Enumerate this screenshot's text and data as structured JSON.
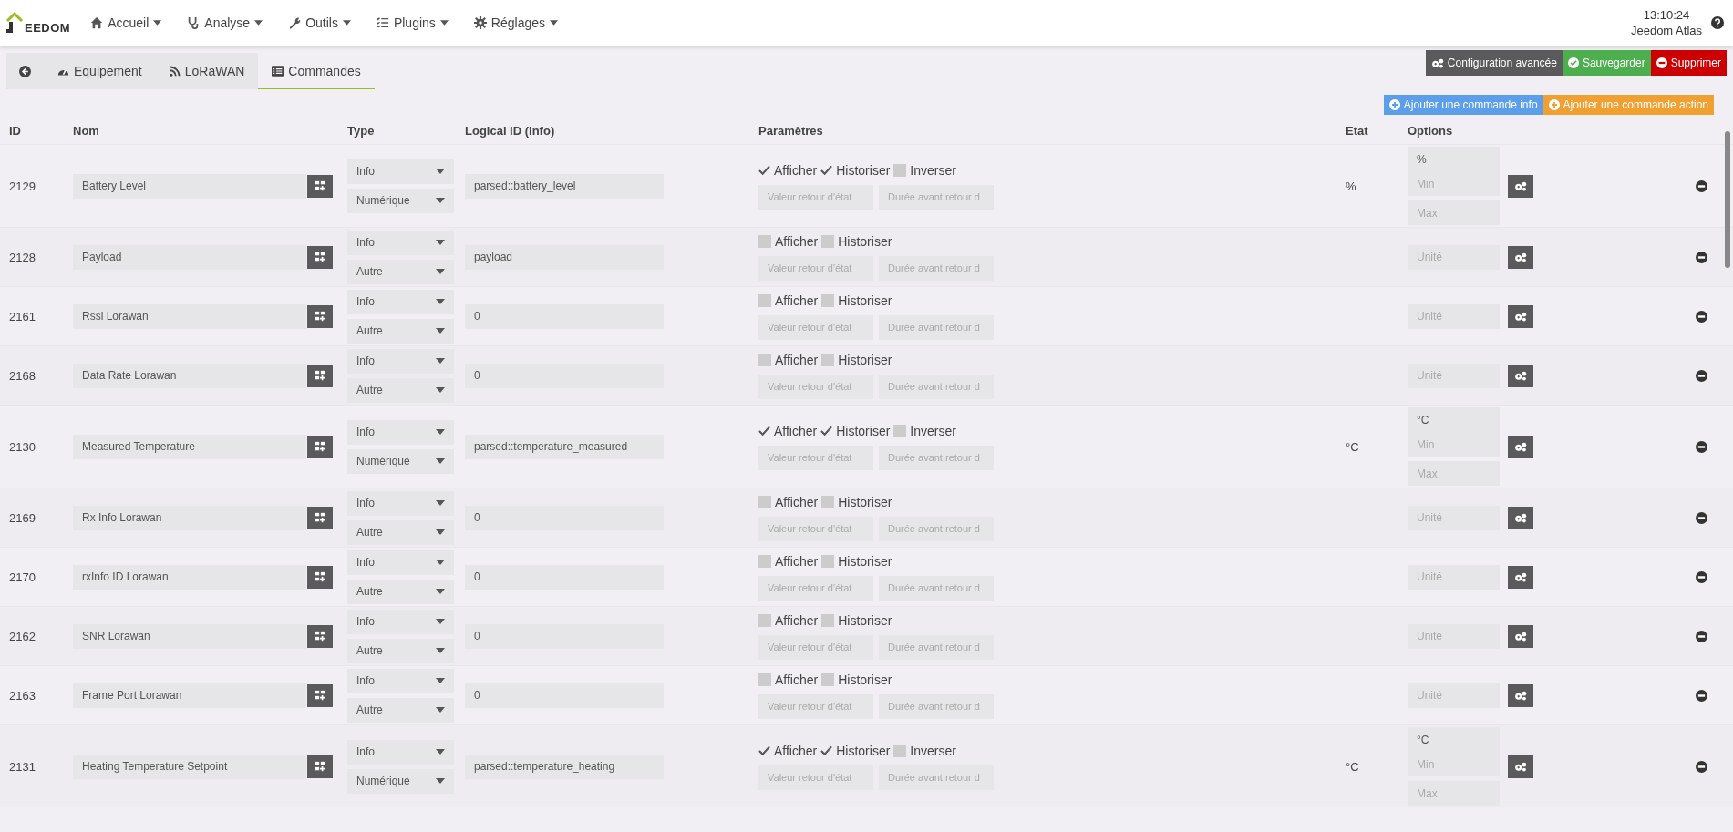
{
  "header": {
    "logo_text": "EEDOM",
    "nav": [
      {
        "label": "Accueil"
      },
      {
        "label": "Analyse"
      },
      {
        "label": "Outils"
      },
      {
        "label": "Plugins"
      },
      {
        "label": "Réglages"
      }
    ],
    "clock": "13:10:24",
    "user": "Jeedom Atlas"
  },
  "tabs": [
    {
      "label": "Equipement",
      "selected": false
    },
    {
      "label": "LoRaWAN",
      "selected": false
    },
    {
      "label": "Commandes",
      "selected": true
    }
  ],
  "actions": [
    "Configuration avancée",
    "Sauvegarder",
    "Supprimer"
  ],
  "add_buttons": [
    "Ajouter une commande info",
    "Ajouter une commande action"
  ],
  "columns": [
    "ID",
    "Nom",
    "Type",
    "Logical ID (info)",
    "Paramètres",
    "Etat",
    "Options"
  ],
  "rows": [
    {
      "kind": "numeric",
      "id": "2129",
      "name": "Battery Level",
      "type": "Info",
      "subtype": "Numérique",
      "logical_id": "parsed::battery_level",
      "afficher": {
        "label": "Afficher",
        "checked": true
      },
      "historiser": {
        "label": "Historiser",
        "checked": true
      },
      "inverser": {
        "label": "Inverser",
        "checked": false
      },
      "return_value_placeholder": "Valeur retour d'état",
      "return_delay_placeholder": "Durée avant retour d",
      "state": "%",
      "unit": "%",
      "min_placeholder": "Min",
      "max_placeholder": "Max"
    },
    {
      "kind": "other",
      "id": "2128",
      "name": "Payload",
      "type": "Info",
      "subtype": "Autre",
      "logical_id": "payload",
      "afficher": {
        "label": "Afficher",
        "checked": false
      },
      "historiser": {
        "label": "Historiser",
        "checked": false
      },
      "return_value_placeholder": "Valeur retour d'état",
      "return_delay_placeholder": "Durée avant retour d",
      "unit_placeholder": "Unité"
    },
    {
      "kind": "other",
      "id": "2161",
      "name": "Rssi Lorawan",
      "type": "Info",
      "subtype": "Autre",
      "logical_id": "0",
      "afficher": {
        "label": "Afficher",
        "checked": false
      },
      "historiser": {
        "label": "Historiser",
        "checked": false
      },
      "return_value_placeholder": "Valeur retour d'état",
      "return_delay_placeholder": "Durée avant retour d",
      "unit_placeholder": "Unité"
    },
    {
      "kind": "other",
      "id": "2168",
      "name": "Data Rate Lorawan",
      "type": "Info",
      "subtype": "Autre",
      "logical_id": "0",
      "afficher": {
        "label": "Afficher",
        "checked": false
      },
      "historiser": {
        "label": "Historiser",
        "checked": false
      },
      "return_value_placeholder": "Valeur retour d'état",
      "return_delay_placeholder": "Durée avant retour d",
      "unit_placeholder": "Unité"
    },
    {
      "kind": "numeric",
      "id": "2130",
      "name": "Measured Temperature",
      "type": "Info",
      "subtype": "Numérique",
      "logical_id": "parsed::temperature_measured",
      "afficher": {
        "label": "Afficher",
        "checked": true
      },
      "historiser": {
        "label": "Historiser",
        "checked": true
      },
      "inverser": {
        "label": "Inverser",
        "checked": false
      },
      "return_value_placeholder": "Valeur retour d'état",
      "return_delay_placeholder": "Durée avant retour d",
      "state": "°C",
      "unit": "°C",
      "min_placeholder": "Min",
      "max_placeholder": "Max"
    },
    {
      "kind": "other",
      "id": "2169",
      "name": "Rx Info Lorawan",
      "type": "Info",
      "subtype": "Autre",
      "logical_id": "0",
      "afficher": {
        "label": "Afficher",
        "checked": false
      },
      "historiser": {
        "label": "Historiser",
        "checked": false
      },
      "return_value_placeholder": "Valeur retour d'état",
      "return_delay_placeholder": "Durée avant retour d",
      "unit_placeholder": "Unité"
    },
    {
      "kind": "other",
      "id": "2170",
      "name": "rxInfo ID Lorawan",
      "type": "Info",
      "subtype": "Autre",
      "logical_id": "0",
      "afficher": {
        "label": "Afficher",
        "checked": false
      },
      "historiser": {
        "label": "Historiser",
        "checked": false
      },
      "return_value_placeholder": "Valeur retour d'état",
      "return_delay_placeholder": "Durée avant retour d",
      "unit_placeholder": "Unité"
    },
    {
      "kind": "other",
      "id": "2162",
      "name": "SNR Lorawan",
      "type": "Info",
      "subtype": "Autre",
      "logical_id": "0",
      "afficher": {
        "label": "Afficher",
        "checked": false
      },
      "historiser": {
        "label": "Historiser",
        "checked": false
      },
      "return_value_placeholder": "Valeur retour d'état",
      "return_delay_placeholder": "Durée avant retour d",
      "unit_placeholder": "Unité"
    },
    {
      "kind": "other",
      "id": "2163",
      "name": "Frame Port Lorawan",
      "type": "Info",
      "subtype": "Autre",
      "logical_id": "0",
      "afficher": {
        "label": "Afficher",
        "checked": false
      },
      "historiser": {
        "label": "Historiser",
        "checked": false
      },
      "return_value_placeholder": "Valeur retour d'état",
      "return_delay_placeholder": "Durée avant retour d",
      "unit_placeholder": "Unité"
    },
    {
      "kind": "numeric",
      "id": "2131",
      "name": "Heating Temperature Setpoint",
      "type": "Info",
      "subtype": "Numérique",
      "logical_id": "parsed::temperature_heating",
      "afficher": {
        "label": "Afficher",
        "checked": true
      },
      "historiser": {
        "label": "Historiser",
        "checked": true
      },
      "inverser": {
        "label": "Inverser",
        "checked": false
      },
      "return_value_placeholder": "Valeur retour d'état",
      "return_delay_placeholder": "Durée avant retour d",
      "state": "°C",
      "unit": "°C",
      "min_placeholder": "Min",
      "max_placeholder": "Max"
    }
  ]
}
